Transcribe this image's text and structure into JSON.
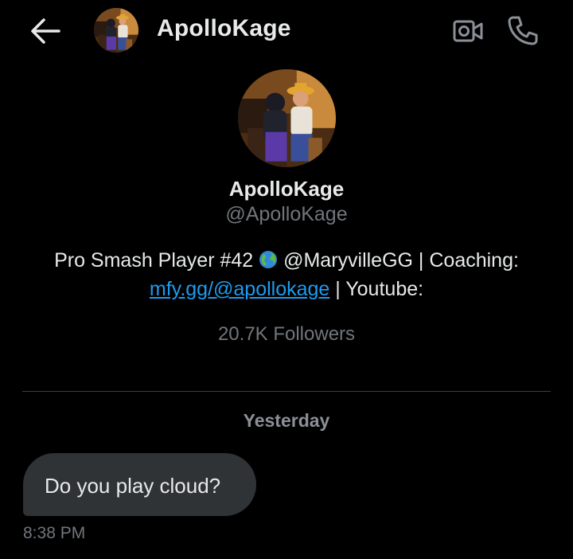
{
  "header": {
    "name": "ApolloKage",
    "icons": {
      "back": "arrow-left-icon",
      "video": "video-camera-icon",
      "call": "phone-icon"
    }
  },
  "profile": {
    "name": "ApolloKage",
    "handle": "@ApolloKage",
    "bio_part1": "Pro Smash Player #42 ",
    "bio_globe": "globe-emoji",
    "bio_part2": " @MaryvilleGG | Coaching: ",
    "bio_link": "mfy.gg/@apollokage",
    "bio_part3": " | Youtube:",
    "followers": "20.7K Followers"
  },
  "conversation": {
    "date_separator": "Yesterday",
    "messages": [
      {
        "text": "Do you play cloud?",
        "time": "8:38 PM"
      }
    ]
  },
  "colors": {
    "background": "#000000",
    "text": "#e7e9ea",
    "secondary_text": "#71767b",
    "link": "#1d9bf0",
    "bubble": "#2f3336"
  }
}
